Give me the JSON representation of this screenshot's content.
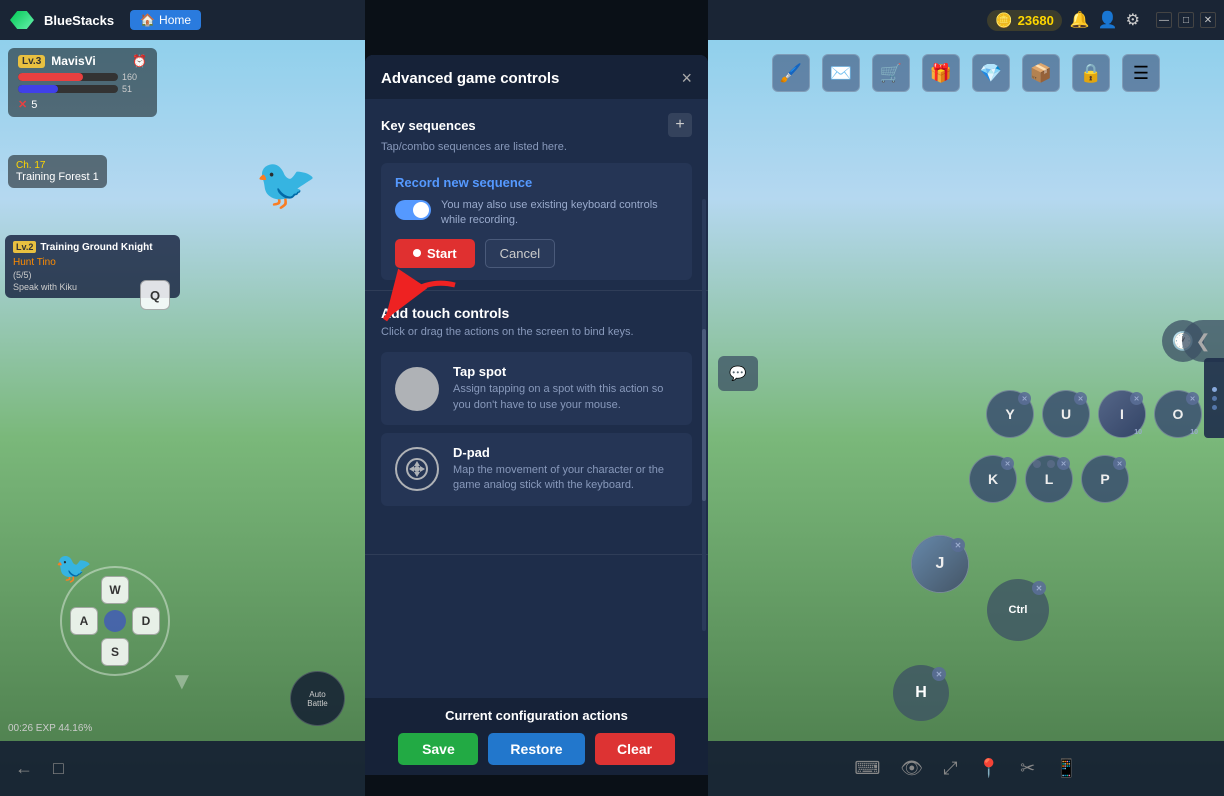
{
  "app": {
    "name": "BlueStacks",
    "home_label": "Home",
    "coin_value": "23680"
  },
  "player": {
    "level": "Lv.3",
    "name": "MavisVi",
    "hp_current": "160",
    "hp_percent": 65,
    "mp_current": "51",
    "mp_percent": 40,
    "xp_label": "5"
  },
  "map": {
    "chapter": "Ch. 17",
    "name": "Training Forest 1"
  },
  "quest": {
    "level": "Lv.2",
    "title": "Training Ground Knight",
    "sub_name": "Hunt Tino",
    "progress": "(5/5)",
    "speak_label": "Speak with Kiku"
  },
  "modal": {
    "title": "Advanced game controls",
    "close_label": "×",
    "key_sequences": {
      "section_title": "Key sequences",
      "section_sub": "Tap/combo sequences are listed here.",
      "add_label": "+",
      "record_title": "Record new sequence",
      "toggle_desc": "You may also use existing keyboard controls while recording.",
      "start_label": "Start",
      "cancel_label": "Cancel"
    },
    "touch_controls": {
      "section_title": "Add touch controls",
      "section_desc": "Click or drag the actions on the screen to bind keys.",
      "tap_spot_title": "Tap spot",
      "tap_spot_desc": "Assign tapping on a spot with this action so you don't have to use your mouse.",
      "dpad_title": "D-pad",
      "dpad_desc": "Map the movement of your character or the game analog stick with the keyboard."
    },
    "config_actions": {
      "title": "Current configuration actions",
      "save_label": "Save",
      "restore_label": "Restore",
      "clear_label": "Clear"
    }
  },
  "right_keys_row1": [
    "Y",
    "U",
    "I",
    "O"
  ],
  "right_keys_row2": [
    "K",
    "L",
    "P"
  ],
  "time_display": "00:26 EXP 44.16%",
  "wasd_keys": {
    "w": "W",
    "a": "A",
    "s": "S",
    "d": "D"
  },
  "bottom_left_icons": [
    "←",
    "□"
  ],
  "bottom_right_icons": [
    "⌨",
    "👁",
    "⤢",
    "📍",
    "✂",
    "📱"
  ]
}
